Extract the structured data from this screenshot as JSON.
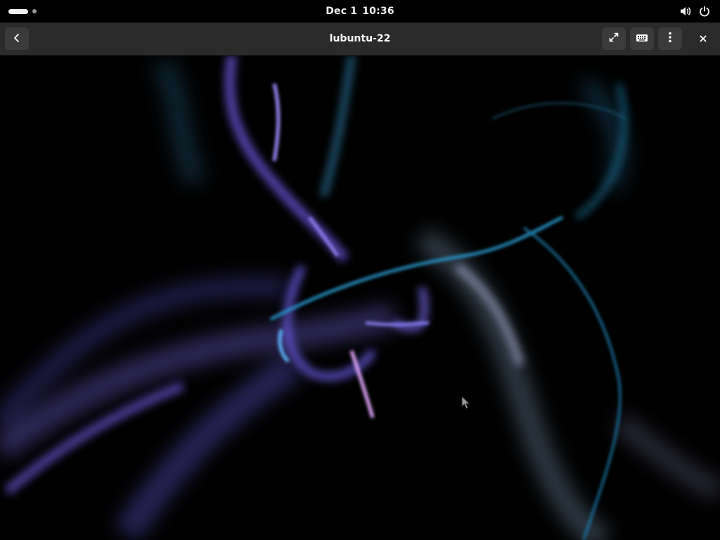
{
  "top_bar": {
    "date": "Dec 1",
    "time": "10:36",
    "icons": [
      "volume-icon",
      "power-icon"
    ]
  },
  "header_bar": {
    "title": "lubuntu-22",
    "buttons": [
      "back-icon",
      "fullscreen-icon",
      "keyboard-icon",
      "menu-dots-icon",
      "close-icon"
    ]
  },
  "colors": {
    "top_bar_bg": "#000000",
    "header_bg": "#2b2b2b",
    "button_bg": "#3b3b3b",
    "wisp_violet": "#8a78ff",
    "wisp_cyan": "#2aa6d6"
  }
}
